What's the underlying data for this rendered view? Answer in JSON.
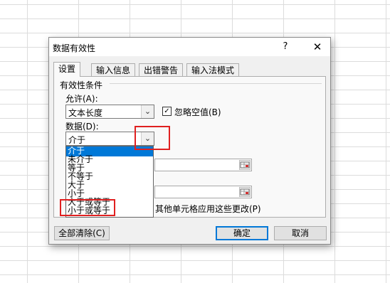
{
  "dialog": {
    "title": "数据有效性",
    "help": "?",
    "close": "✕"
  },
  "tabs": [
    {
      "label": "设置",
      "active": true
    },
    {
      "label": "输入信息",
      "active": false
    },
    {
      "label": "出错警告",
      "active": false
    },
    {
      "label": "输入法模式",
      "active": false
    }
  ],
  "settings": {
    "section_title": "有效性条件",
    "allow_label": "允许(A):",
    "allow_value": "文本长度",
    "ignore_blank_label": "忽略空值(B)",
    "ignore_blank_checked": "✓",
    "data_label": "数据(D):",
    "data_value": "介于",
    "apply_text_fragment": "其他单元格应用这些更改(P)"
  },
  "dropdown_options": [
    "介于",
    "未介于",
    "等于",
    "不等于",
    "大于",
    "小于",
    "大于或等于",
    "小于或等于"
  ],
  "selected_option": "介于",
  "buttons": {
    "clear_all": "全部清除(C)",
    "ok": "确定",
    "cancel": "取消"
  },
  "icons": {
    "dropdown_arrow": "chevron-down-icon",
    "close": "close-icon",
    "range_picker": "range-picker-icon"
  },
  "colors": {
    "highlight": "#0078d7",
    "annotation": "#e02020"
  }
}
